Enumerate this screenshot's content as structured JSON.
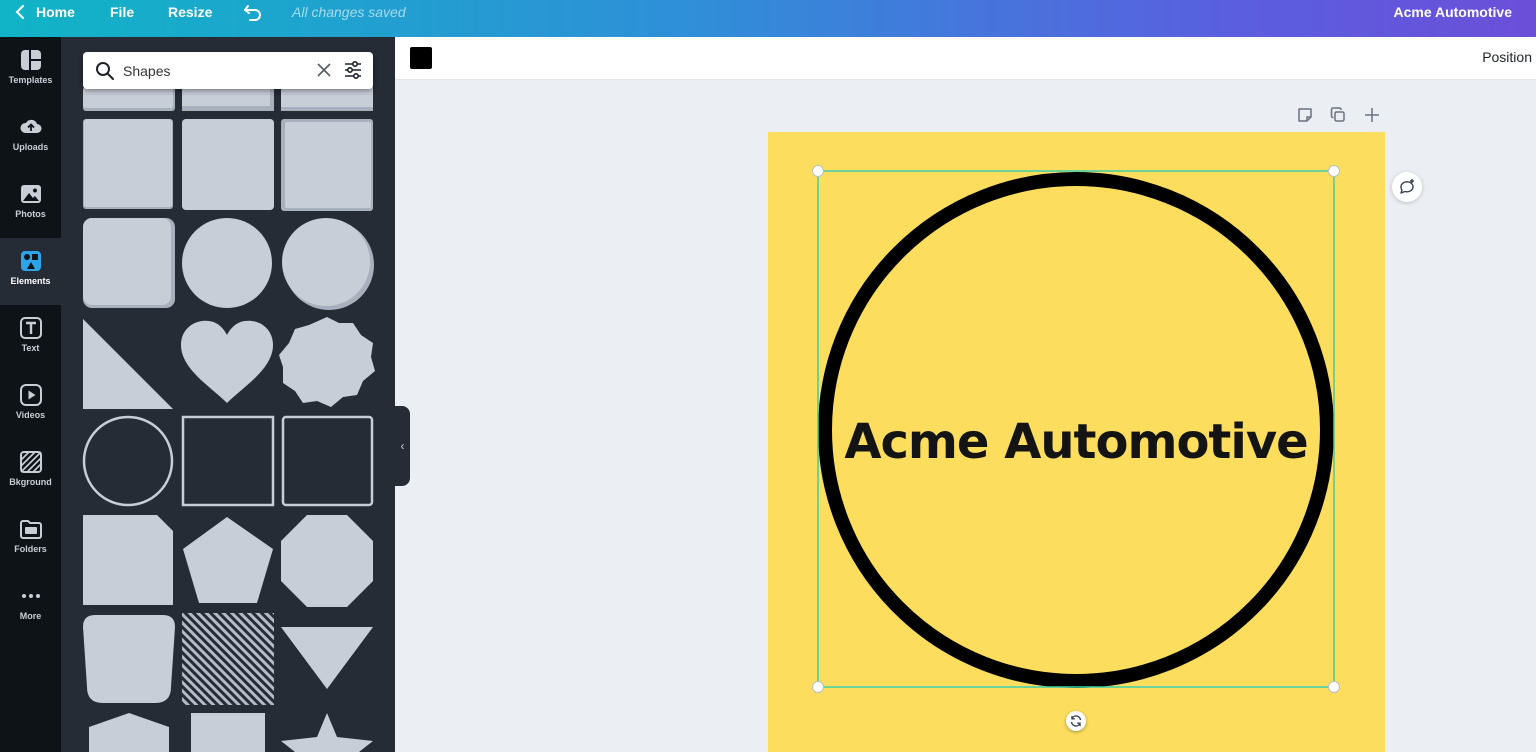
{
  "topbar": {
    "home_label": "Home",
    "file_label": "File",
    "resize_label": "Resize",
    "saved_status": "All changes saved",
    "design_title": "Acme Automotive"
  },
  "rail": {
    "items": [
      {
        "label": "Templates",
        "icon": "templates-icon"
      },
      {
        "label": "Uploads",
        "icon": "upload-icon"
      },
      {
        "label": "Photos",
        "icon": "image-icon"
      },
      {
        "label": "Elements",
        "icon": "elements-icon",
        "active": true
      },
      {
        "label": "Text",
        "icon": "text-icon"
      },
      {
        "label": "Videos",
        "icon": "play-icon"
      },
      {
        "label": "Bkground",
        "icon": "pattern-icon"
      },
      {
        "label": "Folders",
        "icon": "folder-icon"
      },
      {
        "label": "More",
        "icon": "more-icon"
      }
    ]
  },
  "panel": {
    "search_value": "Shapes"
  },
  "toolbar": {
    "fill_color": "#000000",
    "position_label": "Position"
  },
  "canvas": {
    "background_color": "#fcdd5d",
    "circle_stroke_color": "#000000",
    "text": "Acme Automotive",
    "selection_color": "#3ccfa8"
  }
}
